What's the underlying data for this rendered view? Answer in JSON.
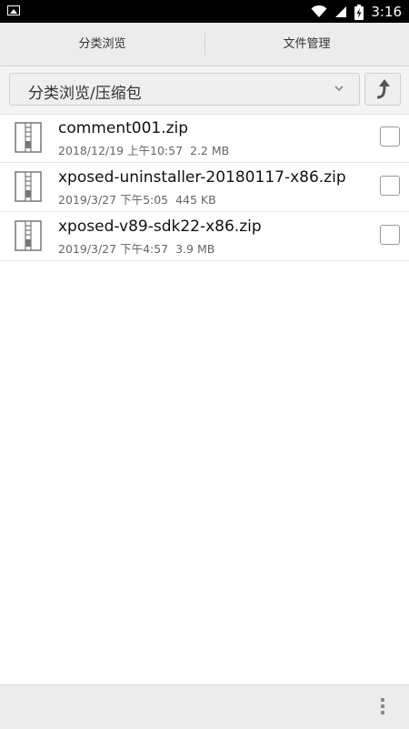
{
  "status_bar": {
    "time": "3:16",
    "icons": [
      "image-notification-icon",
      "wifi-icon",
      "signal-icon",
      "battery-charging-icon"
    ]
  },
  "tabs": [
    {
      "label": "分类浏览",
      "selected": true
    },
    {
      "label": "文件管理",
      "selected": false
    }
  ],
  "path": {
    "label": "分类浏览/压缩包"
  },
  "files": [
    {
      "name": "comment001.zip",
      "date": "2018/12/19 上午10:57",
      "size": "2.2 MB",
      "checked": false
    },
    {
      "name": "xposed-uninstaller-20180117-x86.zip",
      "date": "2019/3/27 下午5:05",
      "size": "445 KB",
      "checked": false
    },
    {
      "name": "xposed-v89-sdk22-x86.zip",
      "date": "2019/3/27 下午4:57",
      "size": "3.9 MB",
      "checked": false
    }
  ],
  "colors": {
    "tab_indicator": "#33b5e5",
    "status_bar": "#000000",
    "toolbar": "#ececec"
  }
}
